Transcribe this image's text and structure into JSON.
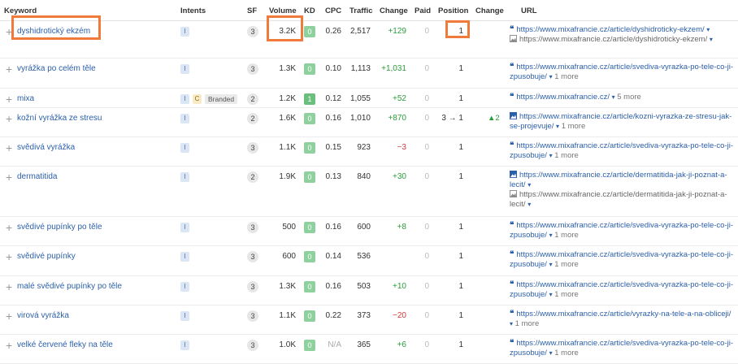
{
  "headers": {
    "keyword": "Keyword",
    "intents": "Intents",
    "sf": "SF",
    "volume": "Volume",
    "kd": "KD",
    "cpc": "CPC",
    "traffic": "Traffic",
    "change": "Change",
    "paid": "Paid",
    "position": "Position",
    "position_change": "Change",
    "url": "URL"
  },
  "rows": [
    {
      "keyword": "dyshidrotický ekzém",
      "intents": [
        "I"
      ],
      "sf": "3",
      "volume": "3.2K",
      "kd": "0",
      "cpc": "0.26",
      "traffic": "2,517",
      "change": "+129",
      "paid": "0",
      "position": "1",
      "position_change": "",
      "urls": [
        {
          "text": "https://www.mixafrancie.cz/article/dyshidroticky-ekzem/",
          "more": ""
        },
        {
          "text": "https://www.mixafrancie.cz/article/dyshidroticky-ekzem/",
          "more": ""
        }
      ]
    },
    {
      "keyword": "vyrážka po celém těle",
      "intents": [
        "I"
      ],
      "sf": "3",
      "volume": "1.3K",
      "kd": "0",
      "cpc": "0.10",
      "traffic": "1,113",
      "change": "+1,031",
      "paid": "0",
      "position": "1",
      "position_change": "",
      "urls": [
        {
          "text": "https://www.mixafrancie.cz/article/svediva-vyrazka-po-tele-co-ji-zpusobuje/",
          "more": "1 more"
        }
      ]
    },
    {
      "keyword": "mixa",
      "intents": [
        "I",
        "C"
      ],
      "branded": "Branded",
      "sf": "2",
      "volume": "1.2K",
      "kd": "1",
      "cpc": "0.12",
      "traffic": "1,055",
      "change": "+52",
      "paid": "0",
      "position": "1",
      "position_change": "",
      "urls": [
        {
          "text": "https://www.mixafrancie.cz/",
          "more": "5 more"
        }
      ]
    },
    {
      "keyword": "kožní vyrážka ze stresu",
      "intents": [
        "I"
      ],
      "sf": "2",
      "volume": "1.6K",
      "kd": "0",
      "cpc": "0.16",
      "traffic": "1,010",
      "change": "+870",
      "paid": "0",
      "position": "3 → 1",
      "position_change": "▲2",
      "urls": [
        {
          "text": "https://www.mixafrancie.cz/article/kozni-vyrazka-ze-stresu-jak-se-projevuje/",
          "more": "1 more"
        }
      ]
    },
    {
      "keyword": "svědivá vyrážka",
      "intents": [
        "I"
      ],
      "sf": "3",
      "volume": "1.1K",
      "kd": "0",
      "cpc": "0.15",
      "traffic": "923",
      "change": "−3",
      "paid": "0",
      "position": "1",
      "position_change": "",
      "urls": [
        {
          "text": "https://www.mixafrancie.cz/article/svediva-vyrazka-po-tele-co-ji-zpusobuje/",
          "more": "1 more"
        }
      ]
    },
    {
      "keyword": "dermatitida",
      "intents": [
        "I"
      ],
      "sf": "2",
      "volume": "1.9K",
      "kd": "0",
      "cpc": "0.13",
      "traffic": "840",
      "change": "+30",
      "paid": "0",
      "position": "1",
      "position_change": "",
      "urls": [
        {
          "text": "https://www.mixafrancie.cz/article/dermatitida-jak-ji-poznat-a-lecit/",
          "more": ""
        },
        {
          "text": "https://www.mixafrancie.cz/article/dermatitida-jak-ji-poznat-a-lecit/",
          "more": ""
        }
      ]
    },
    {
      "keyword": "svědivé pupínky po těle",
      "intents": [
        "I"
      ],
      "sf": "3",
      "volume": "500",
      "kd": "0",
      "cpc": "0.16",
      "traffic": "600",
      "change": "+8",
      "paid": "0",
      "position": "1",
      "position_change": "",
      "urls": [
        {
          "text": "https://www.mixafrancie.cz/article/svediva-vyrazka-po-tele-co-ji-zpusobuje/",
          "more": "1 more"
        }
      ]
    },
    {
      "keyword": "svědivé pupínky",
      "intents": [
        "I"
      ],
      "sf": "3",
      "volume": "600",
      "kd": "0",
      "cpc": "0.14",
      "traffic": "536",
      "change": "",
      "paid": "0",
      "position": "1",
      "position_change": "",
      "urls": [
        {
          "text": "https://www.mixafrancie.cz/article/svediva-vyrazka-po-tele-co-ji-zpusobuje/",
          "more": "1 more"
        }
      ]
    },
    {
      "keyword": "malé svědivé pupínky po těle",
      "intents": [
        "I"
      ],
      "sf": "3",
      "volume": "1.3K",
      "kd": "0",
      "cpc": "0.16",
      "traffic": "503",
      "change": "+10",
      "paid": "0",
      "position": "1",
      "position_change": "",
      "urls": [
        {
          "text": "https://www.mixafrancie.cz/article/svediva-vyrazka-po-tele-co-ji-zpusobuje/",
          "more": "1 more"
        }
      ]
    },
    {
      "keyword": "virová vyrážka",
      "intents": [
        "I"
      ],
      "sf": "3",
      "volume": "1.1K",
      "kd": "0",
      "cpc": "0.22",
      "traffic": "373",
      "change": "−20",
      "paid": "0",
      "position": "1",
      "position_change": "",
      "urls": [
        {
          "text": "https://www.mixafrancie.cz/article/vyrazky-na-tele-a-na-obliceji/",
          "more": "1 more"
        }
      ]
    },
    {
      "keyword": "velké červené fleky na těle",
      "intents": [
        "I"
      ],
      "sf": "3",
      "volume": "1.0K",
      "kd": "0",
      "cpc": "N/A",
      "traffic": "365",
      "change": "+6",
      "paid": "0",
      "position": "1",
      "position_change": "",
      "urls": [
        {
          "text": "https://www.mixafrancie.cz/article/svediva-vyrazka-po-tele-co-ji-zpusobuje/",
          "more": "1 more"
        }
      ]
    }
  ],
  "colors": {
    "link": "#2b5fa8",
    "highlight": "#f07a3a",
    "kd_green": "#8fd19e",
    "positive": "#2a9d3a",
    "negative": "#d23a3a"
  }
}
